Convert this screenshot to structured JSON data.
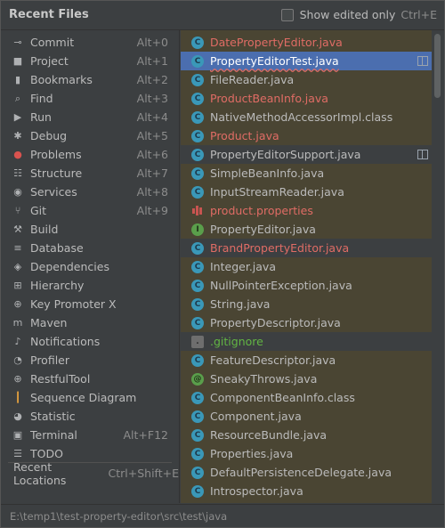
{
  "header": {
    "title": "Recent Files",
    "show_edited_label": "Show edited only",
    "show_edited_shortcut": "Ctrl+E",
    "show_edited_checked": false
  },
  "actions": [
    {
      "label": "Commit",
      "shortcut": "Alt+0",
      "icon": "commit-icon"
    },
    {
      "label": "Project",
      "shortcut": "Alt+1",
      "icon": "folder-icon"
    },
    {
      "label": "Bookmarks",
      "shortcut": "Alt+2",
      "icon": "bookmark-icon"
    },
    {
      "label": "Find",
      "shortcut": "Alt+3",
      "icon": "search-icon"
    },
    {
      "label": "Run",
      "shortcut": "Alt+4",
      "icon": "play-icon"
    },
    {
      "label": "Debug",
      "shortcut": "Alt+5",
      "icon": "bug-icon"
    },
    {
      "label": "Problems",
      "shortcut": "Alt+6",
      "icon": "error-icon"
    },
    {
      "label": "Structure",
      "shortcut": "Alt+7",
      "icon": "structure-icon"
    },
    {
      "label": "Services",
      "shortcut": "Alt+8",
      "icon": "services-icon"
    },
    {
      "label": "Git",
      "shortcut": "Alt+9",
      "icon": "git-branch-icon"
    },
    {
      "label": "Build",
      "shortcut": "",
      "icon": "hammer-icon"
    },
    {
      "label": "Database",
      "shortcut": "",
      "icon": "database-icon"
    },
    {
      "label": "Dependencies",
      "shortcut": "",
      "icon": "layers-icon"
    },
    {
      "label": "Hierarchy",
      "shortcut": "",
      "icon": "hierarchy-icon"
    },
    {
      "label": "Key Promoter X",
      "shortcut": "",
      "icon": "globe-icon"
    },
    {
      "label": "Maven",
      "shortcut": "",
      "icon": "maven-icon"
    },
    {
      "label": "Notifications",
      "shortcut": "",
      "icon": "bell-icon"
    },
    {
      "label": "Profiler",
      "shortcut": "",
      "icon": "profiler-icon"
    },
    {
      "label": "RestfulTool",
      "shortcut": "",
      "icon": "globe-icon"
    },
    {
      "label": "Sequence Diagram",
      "shortcut": "",
      "icon": "sequence-diagram-icon"
    },
    {
      "label": "Statistic",
      "shortcut": "",
      "icon": "statistic-icon"
    },
    {
      "label": "Terminal",
      "shortcut": "Alt+F12",
      "icon": "terminal-icon"
    },
    {
      "label": "TODO",
      "shortcut": "",
      "icon": "list-icon"
    }
  ],
  "recent_locations": {
    "label": "Recent Locations",
    "shortcut": "Ctrl+Shift+E"
  },
  "files": [
    {
      "name": "DatePropertyEditor.java",
      "status": "mod",
      "icon": "class",
      "bg": "gold"
    },
    {
      "name": "PropertyEditorTest.java",
      "status": "mod",
      "icon": "class",
      "bg": "gold",
      "selected": true,
      "split": true
    },
    {
      "name": "FileReader.java",
      "status": "def",
      "icon": "class",
      "bg": "gold"
    },
    {
      "name": "ProductBeanInfo.java",
      "status": "mod",
      "icon": "class",
      "bg": "gold"
    },
    {
      "name": "NativeMethodAccessorImpl.class",
      "status": "def",
      "icon": "class",
      "bg": "gold"
    },
    {
      "name": "Product.java",
      "status": "mod",
      "icon": "class",
      "bg": "gold"
    },
    {
      "name": "PropertyEditorSupport.java",
      "status": "def",
      "icon": "class",
      "bg": "gray",
      "split": true
    },
    {
      "name": "SimpleBeanInfo.java",
      "status": "def",
      "icon": "class",
      "bg": "gold"
    },
    {
      "name": "InputStreamReader.java",
      "status": "def",
      "icon": "class",
      "bg": "gold"
    },
    {
      "name": "product.properties",
      "status": "mod",
      "icon": "properties",
      "bg": "gold"
    },
    {
      "name": "PropertyEditor.java",
      "status": "def",
      "icon": "interface",
      "bg": "gold"
    },
    {
      "name": "BrandPropertyEditor.java",
      "status": "mod",
      "icon": "class",
      "bg": "gray"
    },
    {
      "name": "Integer.java",
      "status": "def",
      "icon": "class",
      "bg": "gold"
    },
    {
      "name": "NullPointerException.java",
      "status": "def",
      "icon": "class",
      "bg": "gold"
    },
    {
      "name": "String.java",
      "status": "def",
      "icon": "class",
      "bg": "gold"
    },
    {
      "name": "PropertyDescriptor.java",
      "status": "def",
      "icon": "class",
      "bg": "gold"
    },
    {
      "name": ".gitignore",
      "status": "add",
      "icon": "gitignore",
      "bg": "gray"
    },
    {
      "name": "FeatureDescriptor.java",
      "status": "def",
      "icon": "class",
      "bg": "gold"
    },
    {
      "name": "SneakyThrows.java",
      "status": "def",
      "icon": "annotation",
      "bg": "gold"
    },
    {
      "name": "ComponentBeanInfo.class",
      "status": "def",
      "icon": "class",
      "bg": "gold"
    },
    {
      "name": "Component.java",
      "status": "def",
      "icon": "class",
      "bg": "gold"
    },
    {
      "name": "ResourceBundle.java",
      "status": "def",
      "icon": "class",
      "bg": "gold"
    },
    {
      "name": "Properties.java",
      "status": "def",
      "icon": "class",
      "bg": "gold"
    },
    {
      "name": "DefaultPersistenceDelegate.java",
      "status": "def",
      "icon": "class",
      "bg": "gold"
    },
    {
      "name": "Introspector.java",
      "status": "def",
      "icon": "class",
      "bg": "gold"
    }
  ],
  "footer": {
    "path": "E:\\temp1\\test-property-editor\\src\\test\\java"
  },
  "colors": {
    "accent": "#4b6eaf",
    "modified": "#e06c65",
    "added": "#62b543",
    "default_text": "#bbbbbb"
  }
}
